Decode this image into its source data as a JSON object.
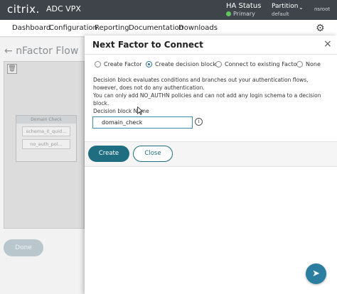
{
  "topbar": {
    "logo": "citrix.",
    "product": "ADC VPX",
    "ha_status_label": "HA Status",
    "ha_status_value": "Primary",
    "ha_status_color": "#62c55b",
    "partition_label": "Partition",
    "partition_value": "default",
    "user": "nsroot"
  },
  "nav": {
    "items": [
      "Dashboard",
      "Configuration",
      "Reporting",
      "Documentation",
      "Downloads"
    ]
  },
  "background": {
    "page_title": "nFactor Flow",
    "block_head": "Domain Check",
    "block_items": [
      "schema_it_quid...",
      "no_auth_pol..."
    ],
    "done_label": "Done"
  },
  "dialog": {
    "title": "Next Factor to Connect",
    "close_glyph": "×",
    "options": [
      {
        "label": "Create Factor",
        "checked": false
      },
      {
        "label": "Create decision block",
        "checked": true
      },
      {
        "label": "Connect to existing Factor",
        "checked": false
      },
      {
        "label": "None",
        "checked": false
      }
    ],
    "description_line1": "Decision block evaluates conditions and branches out your authentication flows, however, does not do any authentication.",
    "description_line2": "You can only add NO_AUTHN policies and can not add any login schema to a decision block.",
    "field_label": "Decision block Name",
    "field_value": "domain_check",
    "create_label": "Create",
    "close_label": "Close"
  },
  "colors": {
    "accent": "#1f6d80",
    "topbar": "#3e4449"
  }
}
